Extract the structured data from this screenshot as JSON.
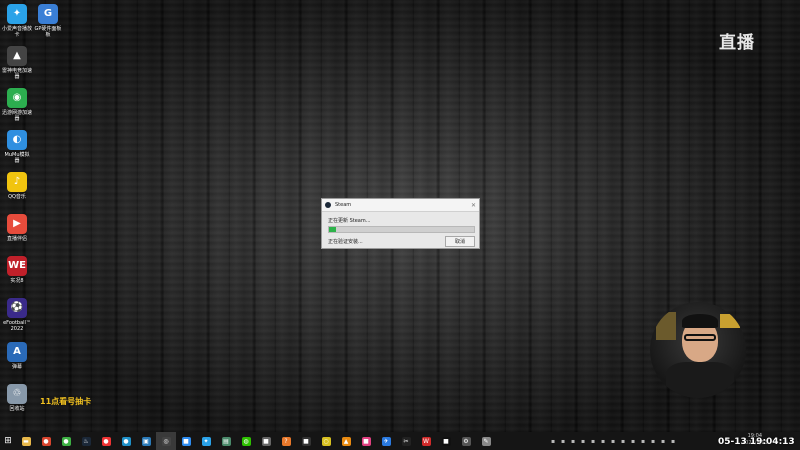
{
  "desktop_icons": [
    {
      "label": "小爱声音播放 卡",
      "icon": "bird-icon",
      "color": "#2aa2e8",
      "glyph": "✦"
    },
    {
      "label": "GP硬件面板 板",
      "icon": "g-logo-icon",
      "color": "#3a7fd6",
      "glyph": "G"
    },
    {
      "label": "雷神电竞加速 器",
      "icon": "eagle-icon",
      "color": "#444",
      "glyph": "▲"
    },
    {
      "label": "迅游网游加速 器",
      "icon": "globe-icon",
      "color": "#2cae4f",
      "glyph": "◉"
    },
    {
      "label": "MuMu模拟 器",
      "icon": "mumu-icon",
      "color": "#2f8fe0",
      "glyph": "◐"
    },
    {
      "label": "QQ音乐",
      "icon": "qq-music-icon",
      "color": "#f1c40f",
      "glyph": "♪"
    },
    {
      "label": "直播伴侣",
      "icon": "live-companion-icon",
      "color": "#e74c3c",
      "glyph": "▶"
    },
    {
      "label": "实况8",
      "icon": "we8-icon",
      "color": "#c0202a",
      "glyph": "WE"
    },
    {
      "label": "eFootball™ 2022",
      "icon": "efootball-icon",
      "color": "#3a2a8a",
      "glyph": "⚽"
    },
    {
      "label": "弹幕",
      "icon": "danmaku-icon",
      "color": "#2a6ab8",
      "glyph": "A"
    },
    {
      "label": "回收站",
      "icon": "recycle-bin-icon",
      "color": "#8899aa",
      "glyph": "♲"
    }
  ],
  "overlay": {
    "live_mark": "直播",
    "promo_text": "11点看号抽卡",
    "time_text": "05-13 19:04:13"
  },
  "dialog": {
    "title": "Steam",
    "status_line1": "正在更新 Steam...",
    "progress": 0.05,
    "status_line2": "正在验证安装...",
    "cancel_label": "取消",
    "progress_color": "#2db34a"
  },
  "taskbar": {
    "apps": [
      {
        "icon": "file-explorer-icon",
        "color": "#e8b84a",
        "glyph": "▬"
      },
      {
        "icon": "chrome-icon",
        "color": "#d8442e",
        "glyph": "●"
      },
      {
        "icon": "360-browser-icon",
        "color": "#3cb043",
        "glyph": "●"
      },
      {
        "icon": "steam-icon",
        "color": "#1b2838",
        "glyph": "♨"
      },
      {
        "icon": "red-app-icon",
        "color": "#e33",
        "glyph": "●"
      },
      {
        "icon": "edge-icon",
        "color": "#1e90c8",
        "glyph": "●"
      },
      {
        "icon": "monitor-app-icon",
        "color": "#2a7ab8",
        "glyph": "▣"
      },
      {
        "icon": "obs-icon",
        "color": "#444",
        "glyph": "◎"
      },
      {
        "icon": "blue-app-icon",
        "color": "#2d8cf0",
        "glyph": "■"
      },
      {
        "icon": "bird-app-icon",
        "color": "#2aa2e8",
        "glyph": "✦"
      },
      {
        "icon": "screen-app-icon",
        "color": "#4a8a6a",
        "glyph": "▤"
      },
      {
        "icon": "wechat-icon",
        "color": "#2dc100",
        "glyph": "◍"
      },
      {
        "icon": "gray-app-icon",
        "color": "#666",
        "glyph": "■"
      },
      {
        "icon": "orange-app-icon",
        "color": "#e8782a",
        "glyph": "?"
      },
      {
        "icon": "dark-app-icon",
        "color": "#333",
        "glyph": "■"
      },
      {
        "icon": "yellow-ring-icon",
        "color": "#d8c020",
        "glyph": "○"
      },
      {
        "icon": "vlc-icon",
        "color": "#e88a10",
        "glyph": "▲"
      },
      {
        "icon": "pink-app-icon",
        "color": "#e04080",
        "glyph": "■"
      },
      {
        "icon": "feather-app-icon",
        "color": "#2a7ae0",
        "glyph": "✈"
      },
      {
        "icon": "capcut-icon",
        "color": "#222",
        "glyph": "✂"
      },
      {
        "icon": "wps-icon",
        "color": "#d02a2a",
        "glyph": "W"
      },
      {
        "icon": "black-app-icon",
        "color": "#111",
        "glyph": "■"
      },
      {
        "icon": "settings-icon",
        "color": "#555",
        "glyph": "⚙"
      },
      {
        "icon": "tool-app-icon",
        "color": "#888",
        "glyph": "✎"
      }
    ],
    "tray_icons": [
      "keyboard-icon",
      "network-icon",
      "chat-icon",
      "wechat-tray-icon",
      "cloud-icon",
      "settings-tray-icon",
      "security-icon",
      "speaker-icon",
      "battery-icon",
      "notification-icon",
      "qq-tray-icon",
      "volume-icon",
      "wifi-icon"
    ],
    "clock_time": "19:04",
    "clock_date": "2022/5/13"
  }
}
